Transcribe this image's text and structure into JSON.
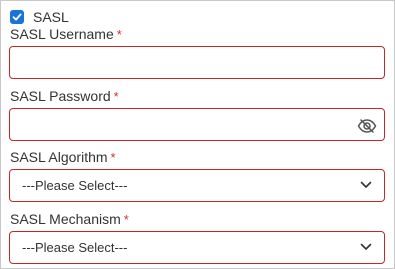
{
  "sasl_checkbox": {
    "label": "SASL",
    "checked": true
  },
  "fields": {
    "username": {
      "label": "SASL Username",
      "required_mark": "*",
      "value": ""
    },
    "password": {
      "label": "SASL Password",
      "required_mark": "*",
      "value": "",
      "toggle_icon": "eye-slash-icon"
    },
    "algorithm": {
      "label": "SASL Algorithm",
      "required_mark": "*",
      "selected": "---Please Select---"
    },
    "mechanism": {
      "label": "SASL Mechanism",
      "required_mark": "*",
      "selected": "---Please Select---"
    }
  },
  "colors": {
    "accent": "#1a73d8",
    "error_border": "#c62828",
    "required": "#d32f2f",
    "text": "#333333"
  }
}
